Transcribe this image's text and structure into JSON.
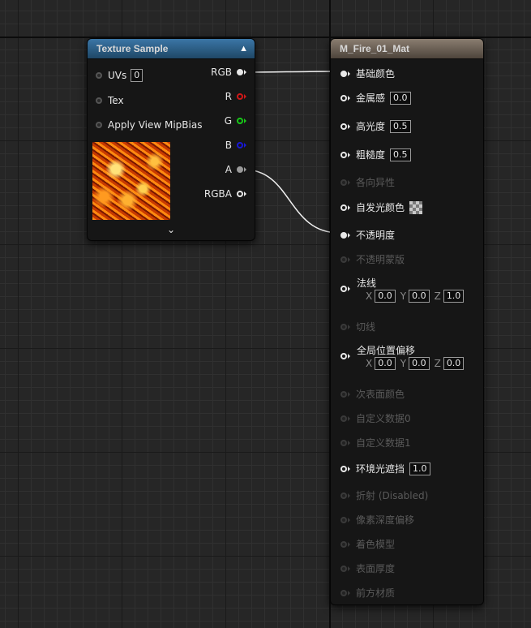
{
  "texture_node": {
    "title": "Texture Sample",
    "collapse_icon": "chevron-up-icon",
    "expand_icon": "chevron-down-icon",
    "inputs": [
      {
        "label": "UVs",
        "value": "0"
      },
      {
        "label": "Tex"
      },
      {
        "label": "Apply View MipBias"
      }
    ],
    "outputs": [
      {
        "label": "RGB",
        "color": "#e8e8e8"
      },
      {
        "label": "R",
        "color": "#d01818"
      },
      {
        "label": "G",
        "color": "#18c818"
      },
      {
        "label": "B",
        "color": "#1818d8"
      },
      {
        "label": "A",
        "color": "#9a9a9a"
      },
      {
        "label": "RGBA",
        "color": "#e8e8e8"
      }
    ]
  },
  "material_node": {
    "title": "M_Fire_01_Mat",
    "pins": [
      {
        "label": "基础颜色"
      },
      {
        "label": "金属感",
        "value": "0.0"
      },
      {
        "label": "高光度",
        "value": "0.5"
      },
      {
        "label": "粗糙度",
        "value": "0.5"
      },
      {
        "label": "各向异性"
      },
      {
        "label": "自发光颜色"
      },
      {
        "label": "不透明度"
      },
      {
        "label": "不透明蒙版"
      },
      {
        "label": "法线",
        "x_label": "X",
        "x": "0.0",
        "y_label": "Y",
        "y": "0.0",
        "z_label": "Z",
        "z": "1.0"
      },
      {
        "label": "切线"
      },
      {
        "label": "全局位置偏移",
        "x_label": "X",
        "x": "0.0",
        "y_label": "Y",
        "y": "0.0",
        "z_label": "Z",
        "z": "0.0"
      },
      {
        "label": "次表面颜色"
      },
      {
        "label": "自定义数据0"
      },
      {
        "label": "自定义数据1"
      },
      {
        "label": "环境光遮挡",
        "value": "1.0"
      },
      {
        "label": "折射 (Disabled)"
      },
      {
        "label": "像素深度偏移"
      },
      {
        "label": "着色模型"
      },
      {
        "label": "表面厚度"
      },
      {
        "label": "前方材质"
      }
    ]
  }
}
